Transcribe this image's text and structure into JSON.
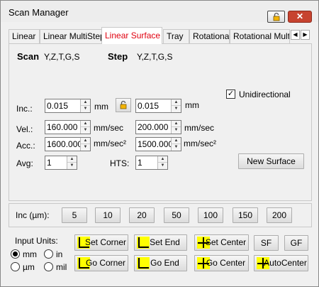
{
  "window": {
    "title": "Scan Manager",
    "close_label": "✕"
  },
  "tabs": [
    "Linear",
    "Linear MultiStep",
    "Linear Surface",
    "Tray",
    "Rotational",
    "Rotational Mult"
  ],
  "tab_scroll": {
    "left": "◀",
    "right": "▶"
  },
  "surface": {
    "scan_label": "Scan",
    "scan_value": "Y,Z,T,G,S",
    "step_label": "Step",
    "step_value": "Y,Z,T,G,S",
    "unidirectional_label": "Unidirectional",
    "unidirectional_checked": true,
    "inc_label": "Inc.:",
    "inc_scan": "0.015",
    "inc_step": "0.015",
    "inc_unit": "mm",
    "vel_label": "Vel.:",
    "vel_scan": "160.000",
    "vel_step": "200.000",
    "vel_unit": "mm/sec",
    "acc_label": "Acc.:",
    "acc_scan": "1600.000",
    "acc_step": "1500.000",
    "acc_unit": "mm/sec²",
    "avg_label": "Avg:",
    "avg_value": "1",
    "hts_label": "HTS:",
    "hts_value": "1",
    "new_surface_label": "New Surface"
  },
  "increments": {
    "label": "Inc (µm):",
    "values": [
      "5",
      "10",
      "20",
      "50",
      "100",
      "150",
      "200"
    ]
  },
  "units": {
    "label": "Input Units:",
    "options": [
      "mm",
      "in",
      "µm",
      "mil"
    ],
    "selected": "mm"
  },
  "actions": {
    "set_corner": "Set Corner",
    "set_end": "Set End",
    "set_center": "Set Center",
    "sf": "SF",
    "gf": "GF",
    "go_corner": "Go Corner",
    "go_end": "Go End",
    "go_center": "Go Center",
    "auto_center": "AutoCenter"
  },
  "colors": {
    "active_tab": "#e0000f",
    "icon_yellow": "#ffff00",
    "close_red": "#c7432f"
  }
}
